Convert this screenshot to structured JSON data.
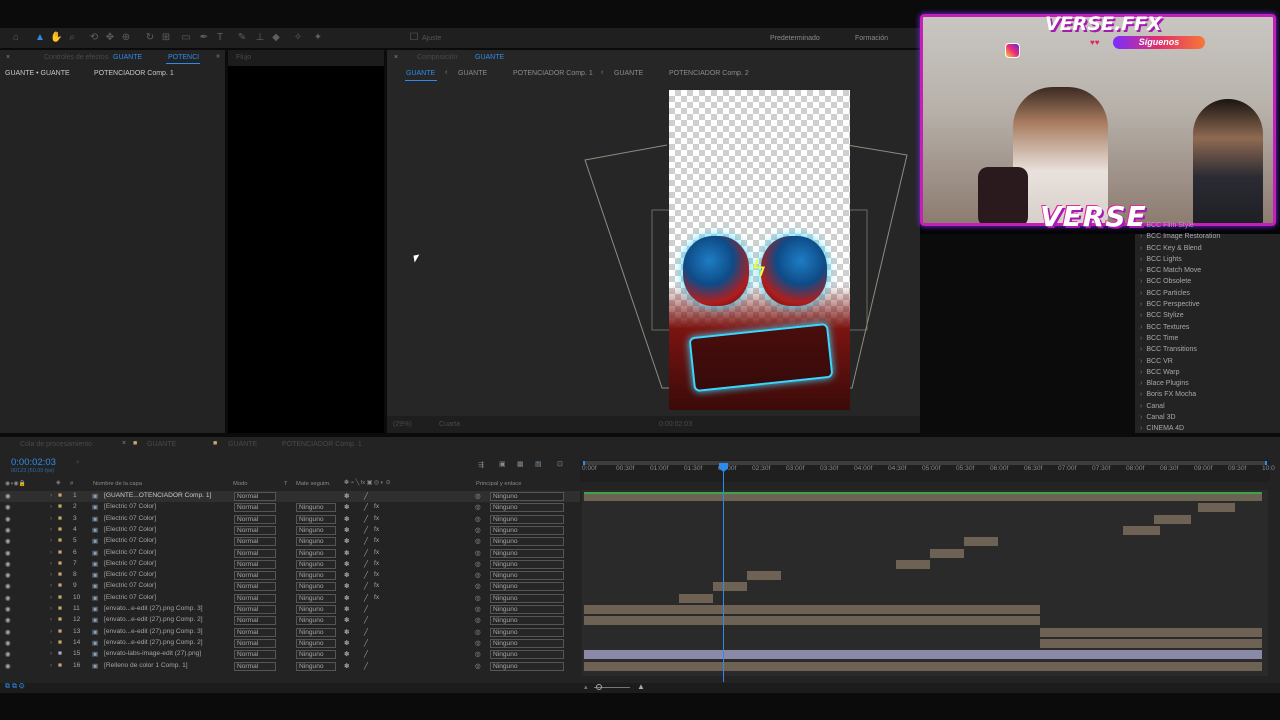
{
  "workspace": {
    "default_label": "Predeterminado",
    "learning_label": "Formación"
  },
  "project_panel": {
    "tab_effects": "Controles de efectos",
    "tab_effects_target": "GUANTE",
    "tab_second": "POTENCI",
    "breadcrumb": "GUANTE • GUANTE",
    "subcomp": "POTENCIADOR Comp. 1"
  },
  "flow_panel": {
    "label": "Flujo"
  },
  "comp_panel": {
    "tab_prefix": "Composición",
    "tab_name": "GUANTE",
    "nav": [
      "GUANTE",
      "GUANTE",
      "POTENCIADOR Comp. 1",
      "GUANTE",
      "POTENCIADOR Comp. 2"
    ],
    "zoom": "(29%)",
    "quality": "Cuarta",
    "timecode": "0:00:02:03"
  },
  "overlay": {
    "brand": "VERSE.FFX",
    "follow": "Síguenos",
    "logo_text": "VERSE"
  },
  "effects_list": [
    "BCC Film Style",
    "BCC Image Restoration",
    "BCC Key & Blend",
    "BCC Lights",
    "BCC Match Move",
    "BCC Obsolete",
    "BCC Particles",
    "BCC Perspective",
    "BCC Stylize",
    "BCC Textures",
    "BCC Time",
    "BCC Transitions",
    "BCC VR",
    "BCC Warp",
    "Blace Plugins",
    "Boris FX Mocha",
    "Canal",
    "Canal 3D",
    "CINEMA 4D"
  ],
  "timeline": {
    "tabs": [
      "Cola de procesamiento",
      "GUANTE",
      "GUANTE",
      "POTENCIADOR Comp. 1"
    ],
    "timecode": "0:00:02:03",
    "frames": "00123 (60.00 fps)",
    "col_name": "Nombre de la capa",
    "col_mode": "Modo",
    "col_t": "T",
    "col_matte": "Mate seguim.",
    "col_parent": "Principal y enlace",
    "ruler": [
      "0:00f",
      "00:30f",
      "01:00f",
      "01:30f",
      "02:00f",
      "02:30f",
      "03:00f",
      "03:30f",
      "04:00f",
      "04:30f",
      "05:00f",
      "05:30f",
      "06:00f",
      "06:30f",
      "07:00f",
      "07:30f",
      "08:00f",
      "08:30f",
      "09:00f",
      "09:30f",
      "10:0"
    ],
    "layers": [
      {
        "num": "1",
        "name": "[GUANTE...OTENCIADOR Comp. 1]",
        "mode": "Normal",
        "matte": "",
        "parent": "Ninguno",
        "fx": ""
      },
      {
        "num": "2",
        "name": "[Electric 07 Color]",
        "mode": "Normal",
        "matte": "Ninguno",
        "parent": "Ninguno",
        "fx": "fx"
      },
      {
        "num": "3",
        "name": "[Electric 07 Color]",
        "mode": "Normal",
        "matte": "Ninguno",
        "parent": "Ninguno",
        "fx": "fx"
      },
      {
        "num": "4",
        "name": "[Electric 07 Color]",
        "mode": "Normal",
        "matte": "Ninguno",
        "parent": "Ninguno",
        "fx": "fx"
      },
      {
        "num": "5",
        "name": "[Electric 07 Color]",
        "mode": "Normal",
        "matte": "Ninguno",
        "parent": "Ninguno",
        "fx": "fx"
      },
      {
        "num": "6",
        "name": "[Electric 07 Color]",
        "mode": "Normal",
        "matte": "Ninguno",
        "parent": "Ninguno",
        "fx": "fx"
      },
      {
        "num": "7",
        "name": "[Electric 07 Color]",
        "mode": "Normal",
        "matte": "Ninguno",
        "parent": "Ninguno",
        "fx": "fx"
      },
      {
        "num": "8",
        "name": "[Electric 07 Color]",
        "mode": "Normal",
        "matte": "Ninguno",
        "parent": "Ninguno",
        "fx": "fx"
      },
      {
        "num": "9",
        "name": "[Electric 07 Color]",
        "mode": "Normal",
        "matte": "Ninguno",
        "parent": "Ninguno",
        "fx": "fx"
      },
      {
        "num": "10",
        "name": "[Electric 07 Color]",
        "mode": "Normal",
        "matte": "Ninguno",
        "parent": "Ninguno",
        "fx": "fx"
      },
      {
        "num": "11",
        "name": "[envato...e-edit (27).png Comp. 3]",
        "mode": "Normal",
        "matte": "Ninguno",
        "parent": "Ninguno",
        "fx": ""
      },
      {
        "num": "12",
        "name": "[envato...e-edit (27).png Comp. 2]",
        "mode": "Normal",
        "matte": "Ninguno",
        "parent": "Ninguno",
        "fx": ""
      },
      {
        "num": "13",
        "name": "[envato...e-edit (27).png Comp. 3]",
        "mode": "Normal",
        "matte": "Ninguno",
        "parent": "Ninguno",
        "fx": ""
      },
      {
        "num": "14",
        "name": "[envato...e-edit (27).png Comp. 2]",
        "mode": "Normal",
        "matte": "Ninguno",
        "parent": "Ninguno",
        "fx": ""
      },
      {
        "num": "15",
        "name": "[envato-labs-image-edit (27).png]",
        "mode": "Normal",
        "matte": "Ninguno",
        "parent": "Ninguno",
        "fx": ""
      },
      {
        "num": "16",
        "name": "[Relleno de color 1 Comp. 1]",
        "mode": "Normal",
        "matte": "Ninguno",
        "parent": "Ninguno",
        "fx": ""
      }
    ]
  },
  "colors": {
    "accent_blue": "#2d8ceb",
    "track_brown": "#6e6254",
    "track_green": "#3fa34d",
    "overlay_magenta": "#c41fb6"
  }
}
